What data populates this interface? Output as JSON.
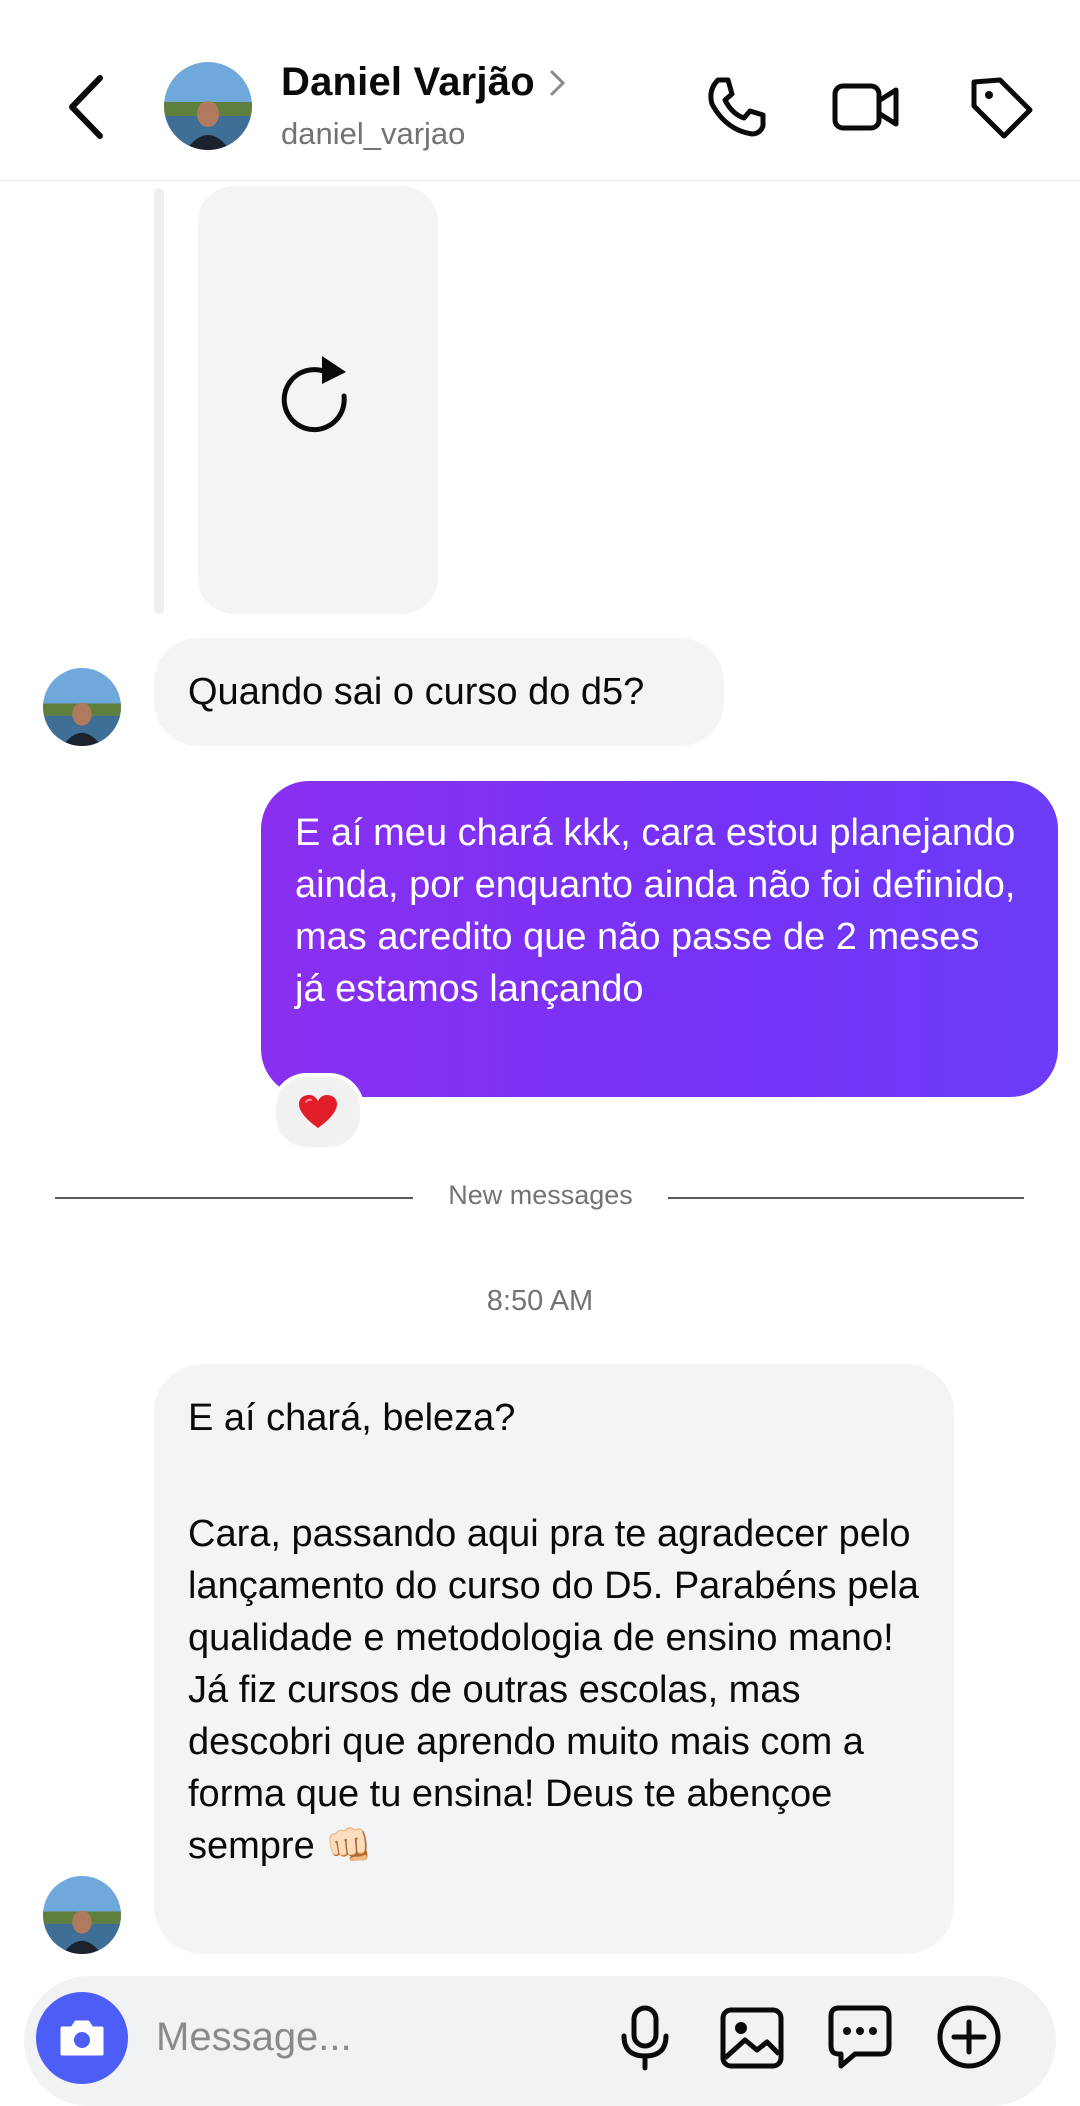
{
  "header": {
    "name": "Daniel Varjão",
    "username": "daniel_varjao"
  },
  "messages": [
    {
      "direction": "incoming",
      "text": "Quando sai o curso do d5?"
    },
    {
      "direction": "outgoing",
      "text": "E aí meu chará kkk, cara estou planejando ainda, por enquanto ainda não foi definido, mas acredito que não passe de 2 meses já estamos lançando",
      "reaction": "❤️"
    }
  ],
  "divider": {
    "label": "New messages"
  },
  "timestamp": "8:50 AM",
  "latest_message": {
    "greeting": "E aí chará, beleza?",
    "body": "Cara, passando aqui pra te agradecer pelo lançamento do curso do D5. Parabéns pela qualidade e metodologia de ensino mano! Já fiz cursos de outras escolas, mas descobri que aprendo muito mais com a forma que tu ensina! Deus te abençoe sempre 👊🏻"
  },
  "composer": {
    "placeholder": "Message..."
  },
  "icons": {
    "back": "back-icon",
    "phone": "phone-icon",
    "video": "video-icon",
    "tag": "tag-icon",
    "reload": "reload-icon",
    "camera": "camera-icon",
    "mic": "microphone-icon",
    "gallery": "gallery-icon",
    "sticker": "sticker-icon",
    "plus": "plus-icon"
  },
  "colors": {
    "outgoing_start": "#8a2ff0",
    "outgoing_end": "#6c3cf8",
    "incoming_bg": "#f3f4f6",
    "camera_button": "#4c5ef6"
  }
}
